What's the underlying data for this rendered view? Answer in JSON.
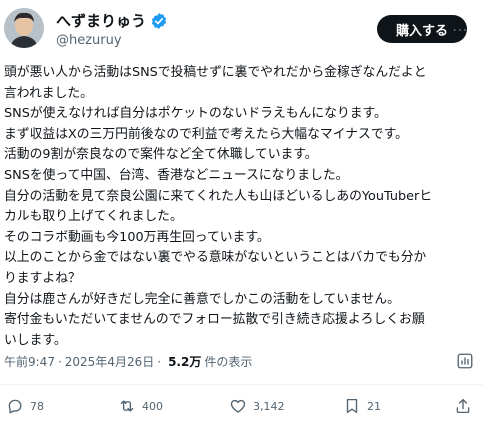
{
  "user": {
    "display_name": "へずまりゅう",
    "handle": "@hezuruy",
    "verified": true,
    "verified_color": "#1d9bf0"
  },
  "header": {
    "buy_label": "購入する",
    "more_icon": "more-horizontal-icon"
  },
  "post": {
    "lines": [
      "頭が悪い人から活動はSNSで投稿せずに裏でやれだから金稼ぎなんだよと",
      "言われました。",
      "SNSが使えなければ自分はポケットのないドラえもんになります。",
      "まず収益はXの三万円前後なので利益で考えたら大幅なマイナスです。",
      "活動の9割が奈良なので案件など全て休職しています。",
      "SNSを使って中国、台湾、香港などニュースになりました。",
      "自分の活動を見て奈良公園に来てくれた人も山ほどいるしあのYouTuberヒ",
      "カルも取り上げてくれました。",
      "そのコラボ動画も今100万再生回っています。",
      "以上のことから金ではない裏でやる意味がないということはバカでも分か",
      "りますよね？",
      "自分は鹿さんが好きだし完全に善意でしかこの活動をしていません。",
      "寄付金もいただいてませんのでフォロー拡散で引き続き応援よろしくお願",
      "いします。"
    ]
  },
  "meta": {
    "time": "午前9:47",
    "separator": "·",
    "date": "2025年4月26日",
    "views": "5.2万",
    "views_label": "件の表示"
  },
  "actions": {
    "replies": "78",
    "reposts": "400",
    "likes": "3,142",
    "bookmarks": "21"
  }
}
